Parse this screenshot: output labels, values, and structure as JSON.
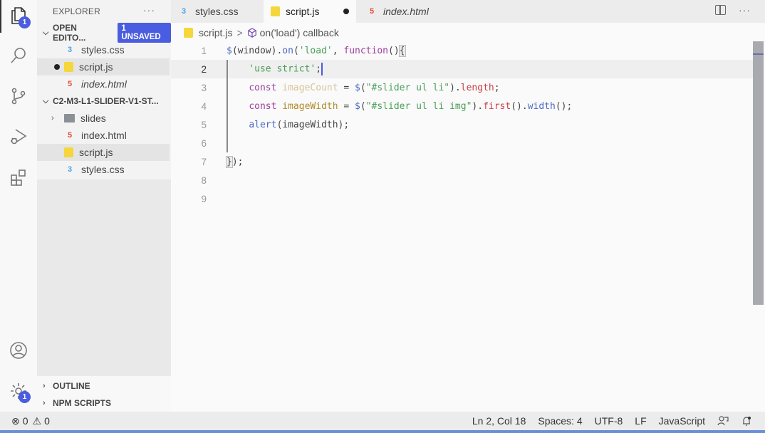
{
  "activity_bar": {
    "explorer_badge": "1",
    "settings_badge": "1",
    "icons": [
      "files-icon",
      "search-icon",
      "source-control-icon",
      "run-debug-icon",
      "extensions-icon",
      "account-icon",
      "settings-gear-icon"
    ]
  },
  "sidebar": {
    "title": "EXPLORER",
    "more": "···",
    "open_editors": {
      "label": "OPEN EDITO...",
      "badge": "1 UNSAVED",
      "items": [
        {
          "name": "styles.css",
          "type": "css"
        },
        {
          "name": "script.js",
          "type": "js",
          "dirty": true
        },
        {
          "name": "index.html",
          "type": "html"
        }
      ]
    },
    "folder": {
      "label": "C2-M3-L1-SLIDER-V1-ST...",
      "items": [
        {
          "name": "slides",
          "type": "folder"
        },
        {
          "name": "index.html",
          "type": "html"
        },
        {
          "name": "script.js",
          "type": "js"
        },
        {
          "name": "styles.css",
          "type": "css"
        }
      ]
    },
    "outline": "OUTLINE",
    "npm_scripts": "NPM SCRIPTS"
  },
  "tabs": [
    {
      "label": "styles.css",
      "type": "css"
    },
    {
      "label": "script.js",
      "type": "js",
      "active": true,
      "dirty": true
    },
    {
      "label": "index.html",
      "type": "html"
    }
  ],
  "breadcrumb": {
    "file": "script.js",
    "separator": ">",
    "symbol": "on('load') callback"
  },
  "editor": {
    "line_numbers": [
      "1",
      "2",
      "3",
      "4",
      "5",
      "6",
      "7",
      "8",
      "9"
    ],
    "current_line": 2,
    "lines": {
      "l1": {
        "a": "$",
        "b": "(window).",
        "c": "on",
        "d": "(",
        "e": "'load'",
        "f": ", ",
        "g": "function",
        "h": "()",
        "i": "{"
      },
      "l2": {
        "a": "'use strict'",
        "b": ";"
      },
      "l3": {
        "a": "const",
        "b": "imageCount",
        "c": " = ",
        "d": "$",
        "e": "(",
        "f": "\"#slider ul li\"",
        "g": ").",
        "h": "length",
        "i": ";"
      },
      "l4": {
        "a": "const",
        "b": "imageWidth",
        "c": " = ",
        "d": "$",
        "e": "(",
        "f": "\"#slider ul li img\"",
        "g": ").",
        "h": "first",
        "i": "().",
        "j": "width",
        "k": "();"
      },
      "l5": {
        "a": "alert",
        "b": "(imageWidth);"
      },
      "l7": {
        "a": "}",
        "b": ");"
      }
    }
  },
  "statusbar": {
    "errors": "0",
    "warnings": "0",
    "position": "Ln 2, Col 18",
    "spaces": "Spaces: 4",
    "encoding": "UTF-8",
    "eol": "LF",
    "language": "JavaScript"
  },
  "colors": {
    "accent": "#4a5de0",
    "keyword": "#9c3e9e",
    "string": "#4a9f59",
    "function": "#4b69c6",
    "property": "#cc3e44"
  }
}
